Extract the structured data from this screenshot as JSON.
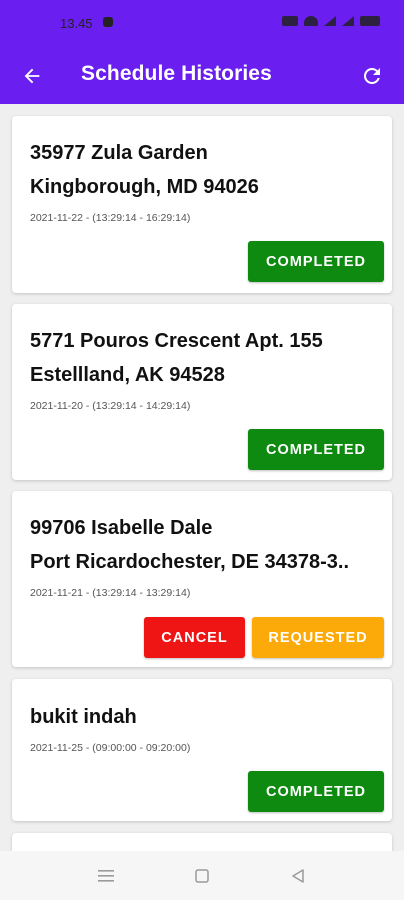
{
  "status_bar": {
    "time": "13.45"
  },
  "app_bar": {
    "title": "Schedule Histories"
  },
  "schedules": [
    {
      "address_line1": "35977 Zula Garden",
      "address_line2": "Kingborough, MD 94026",
      "time": "2021-11-22 - (13:29:14 - 16:29:14)",
      "status": "COMPLETED"
    },
    {
      "address_line1": "5771 Pouros Crescent Apt. 155",
      "address_line2": "Estellland, AK 94528",
      "time": "2021-11-20 - (13:29:14 - 14:29:14)",
      "status": "COMPLETED"
    },
    {
      "address_line1": "99706 Isabelle Dale",
      "address_line2": "Port Ricardochester, DE 34378-3..",
      "time": "2021-11-21 - (13:29:14 - 13:29:14)",
      "cancel_label": "CANCEL",
      "status": "REQUESTED"
    },
    {
      "address_line1": "bukit indah",
      "time": "2021-11-25 - (09:00:00 - 09:20:00)",
      "status": "COMPLETED"
    }
  ],
  "colors": {
    "primary": "#6a1ef0",
    "completed": "#0e8a10",
    "cancel": "#f01515",
    "requested": "#fbaa0a"
  },
  "icons": {
    "back": "arrow-left-icon",
    "refresh": "refresh-icon",
    "nav_menu": "menu-icon",
    "nav_home": "square-icon",
    "nav_back": "triangle-back-icon"
  }
}
